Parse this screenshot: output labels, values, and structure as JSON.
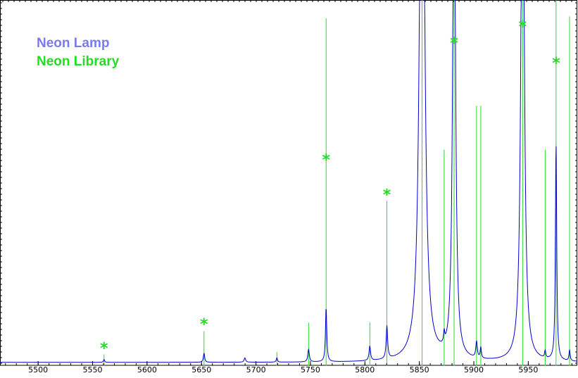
{
  "chart_data": {
    "type": "line",
    "title": "",
    "xlabel": "",
    "ylabel": "",
    "xlim": [
      5465,
      5995
    ],
    "ylim": [
      0,
      1
    ],
    "xticks": [
      5500,
      5550,
      5600,
      5650,
      5700,
      5750,
      5800,
      5850,
      5900,
      5950
    ],
    "tick_labels": [
      "5500",
      "5550",
      "5600",
      "5650",
      "5700",
      "5750",
      "5800",
      "5850",
      "5900",
      "5950"
    ],
    "grid": false,
    "legend_placement": "top-left",
    "series": [
      {
        "name": "Neon Lamp",
        "color": "#0000cc",
        "baseline": 0.008,
        "peaks": [
          {
            "x": 5560.5,
            "h": 0.008,
            "w": 0.6
          },
          {
            "x": 5652.3,
            "h": 0.025,
            "w": 0.7
          },
          {
            "x": 5689.8,
            "h": 0.012,
            "w": 0.8
          },
          {
            "x": 5719.2,
            "h": 0.012,
            "w": 0.6
          },
          {
            "x": 5748.3,
            "h": 0.035,
            "w": 0.8
          },
          {
            "x": 5764.4,
            "h": 0.15,
            "w": 0.7
          },
          {
            "x": 5804.5,
            "h": 0.04,
            "w": 0.8
          },
          {
            "x": 5820.2,
            "h": 0.09,
            "w": 0.8
          },
          {
            "x": 5852.5,
            "h": 2.2,
            "w": 2.2
          },
          {
            "x": 5872.8,
            "h": 0.03,
            "w": 0.6
          },
          {
            "x": 5881.9,
            "h": 1.6,
            "w": 1.4
          },
          {
            "x": 5902.5,
            "h": 0.045,
            "w": 0.8
          },
          {
            "x": 5906.4,
            "h": 0.03,
            "w": 0.6
          },
          {
            "x": 5944.8,
            "h": 1.8,
            "w": 1.6
          },
          {
            "x": 5965.5,
            "h": 0.02,
            "w": 0.6
          },
          {
            "x": 5975.5,
            "h": 0.6,
            "w": 0.7
          },
          {
            "x": 5987.9,
            "h": 0.03,
            "w": 0.6
          }
        ]
      },
      {
        "name": "Neon Library",
        "color": "#22dd22",
        "lines": [
          {
            "x": 5560.5,
            "y": 0.03
          },
          {
            "x": 5652.3,
            "y": 0.093
          },
          {
            "x": 5719.2,
            "y": 0.036
          },
          {
            "x": 5748.3,
            "y": 0.117
          },
          {
            "x": 5764.4,
            "y": 0.95
          },
          {
            "x": 5804.5,
            "y": 0.118
          },
          {
            "x": 5820.2,
            "y": 0.45
          },
          {
            "x": 5852.5,
            "y": 1.0
          },
          {
            "x": 5872.8,
            "y": 0.59
          },
          {
            "x": 5881.9,
            "y": 1.0
          },
          {
            "x": 5902.5,
            "y": 0.71
          },
          {
            "x": 5906.4,
            "y": 0.71
          },
          {
            "x": 5944.8,
            "y": 1.0
          },
          {
            "x": 5965.5,
            "y": 0.59
          },
          {
            "x": 5975.5,
            "y": 1.0
          },
          {
            "x": 5987.9,
            "y": 0.955
          }
        ]
      }
    ],
    "annotations": [
      {
        "x": 5560.5,
        "text": "*",
        "y": 0.06
      },
      {
        "x": 5652.3,
        "text": "*",
        "y": 0.125
      },
      {
        "x": 5764.4,
        "text": "*",
        "y": 0.575
      },
      {
        "x": 5820.2,
        "text": "*",
        "y": 0.48
      },
      {
        "x": 5881.9,
        "text": "*",
        "y": 0.895
      },
      {
        "x": 5944.8,
        "text": "*",
        "y": 0.94
      },
      {
        "x": 5975.5,
        "text": "*",
        "y": 0.84
      }
    ]
  }
}
